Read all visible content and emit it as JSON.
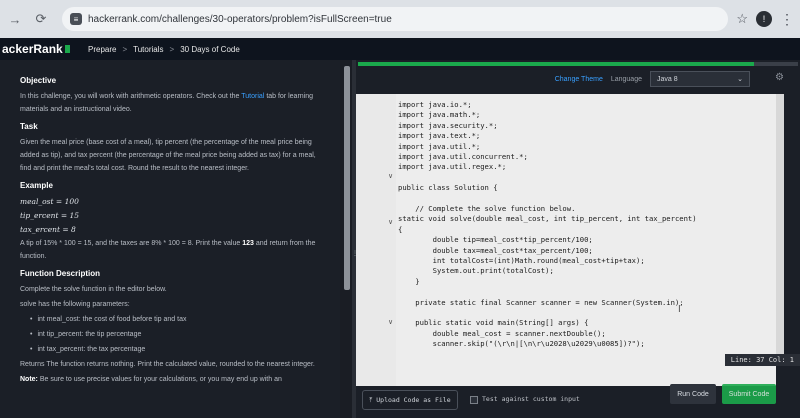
{
  "browser": {
    "url": "hackerrank.com/challenges/30-operators/problem?isFullScreen=true",
    "back_icon": "arrow-right-icon",
    "reload_icon": "reload-icon"
  },
  "nav": {
    "logo": "ackerRank",
    "crumbs": [
      "Prepare",
      "Tutorials",
      "30 Days of Code"
    ],
    "separator": ">"
  },
  "problem": {
    "objective_heading": "Objective",
    "objective_text_1": "In this challenge, you will work with arithmetic operators. Check out the",
    "objective_link": "Tutorial",
    "objective_text_2": "tab for learning materials and an instructional video.",
    "task_heading": "Task",
    "task_text": "Given the meal price (base cost of a meal), tip percent (the percentage of the meal price being added as tip), and tax percent (the percentage of the meal price being added as tax) for a meal, find and print the meal's total cost. Round the result to the nearest integer.",
    "example_heading": "Example",
    "example_lines": [
      "meal_ost = 100",
      "tip_ercent = 15",
      "tax_ercent = 8"
    ],
    "example_explain_1": "A tip of 15% * 100 = 15, and the taxes are 8% * 100 = 8. Print the value",
    "example_value": "123",
    "example_explain_2": "and return from the function.",
    "function_heading": "Function Description",
    "function_text": "Complete the solve function in the editor below.",
    "params_intro": "solve has the following parameters:",
    "params": [
      "int meal_cost: the cost of food before tip and tax",
      "int tip_percent: the tip percentage",
      "int tax_percent: the tax percentage"
    ],
    "returns_text": "Returns The function returns nothing. Print the calculated value, rounded to the nearest integer.",
    "note_label": "Note:",
    "note_text": "Be sure to use precise values for your calculations, or you may end up with an"
  },
  "editor": {
    "change_theme": "Change Theme",
    "language_label": "Language",
    "language_value": "Java 8",
    "line_indicator": "Line: 37 Col: 1",
    "upload_label": "Upload Code as File",
    "test_label": "Test against custom input",
    "run_label": "Run Code",
    "submit_label": "Submit Code",
    "progress": 0.9
  },
  "code": [
    "import java.io.*;",
    "import java.math.*;",
    "import java.security.*;",
    "import java.text.*;",
    "import java.util.*;",
    "import java.util.concurrent.*;",
    "import java.util.regex.*;",
    "",
    "public class Solution {",
    "",
    "    // Complete the solve function below.",
    "static void solve(double meal_cost, int tip_percent, int tax_percent)",
    "{",
    "        double tip=meal_cost*tip_percent/100;",
    "        double tax=meal_cost*tax_percent/100;",
    "        int totalCost=(int)Math.round(meal_cost+tip+tax);",
    "        System.out.print(totalCost);",
    "    }",
    "",
    "    private static final Scanner scanner = new Scanner(System.in);",
    "",
    "    public static void main(String[] args) {",
    "        double meal_cost = scanner.nextDouble();",
    "        scanner.skip(\"(\\r\\n|[\\n\\r\\u2028\\u2029\\u0085])?\");"
  ]
}
